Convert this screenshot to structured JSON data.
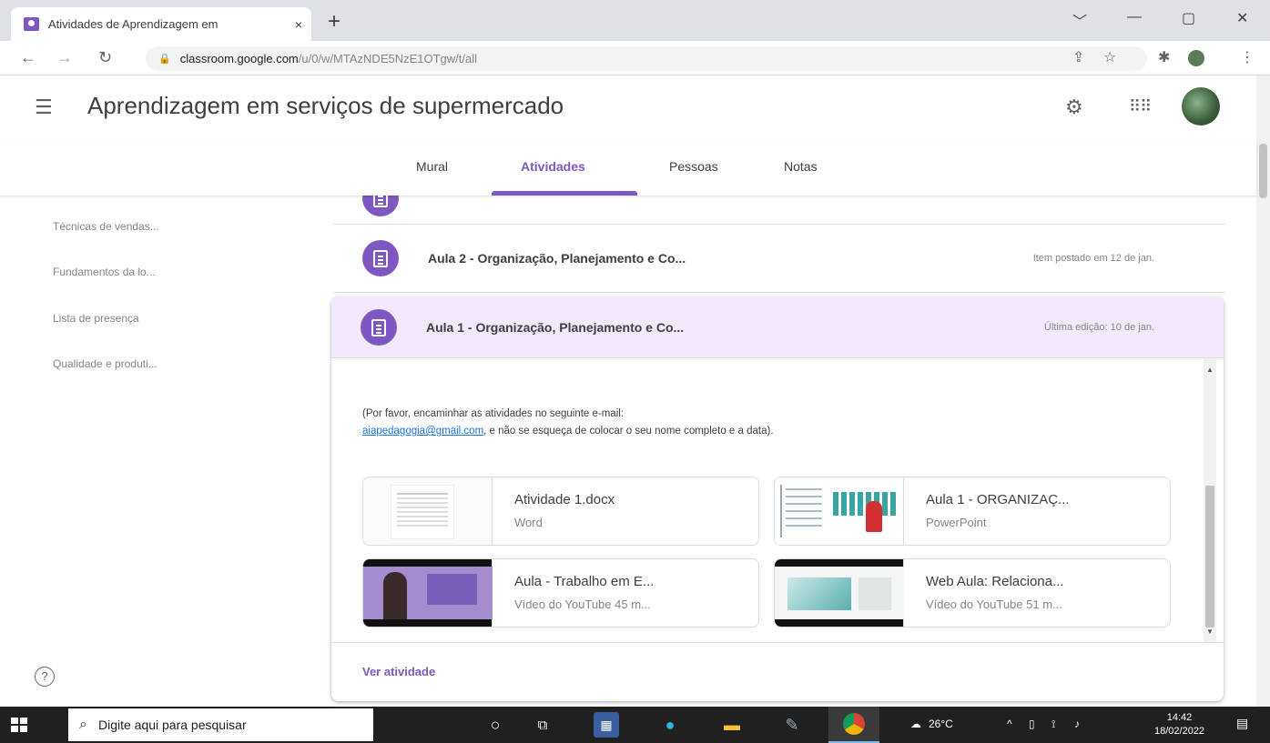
{
  "browser": {
    "tab_title": "Atividades de Aprendizagem em",
    "tab_close": "×",
    "new_tab": "+",
    "url_host": "classroom.google.com",
    "url_path": "/u/0/w/MTAzNDE5NzE1OTgw/t/all",
    "window_controls": [
      "﹀",
      "—",
      "▢",
      "✕"
    ]
  },
  "header": {
    "class_name": "Aprendizagem em serviços de supermercado"
  },
  "class_tabs": [
    "Mural",
    "Atividades",
    "Pessoas",
    "Notas"
  ],
  "active_tab": "Atividades",
  "topics": [
    "Técnicas de vendas...",
    "Fundamentos da lo...",
    "Lista de presença",
    "Qualidade e produti..."
  ],
  "items": [
    {
      "title": "Aula 2 - Organização, Planejamento e Co...",
      "meta": "Item postado em 12 de jan."
    },
    {
      "title": "Aula 1 - Organização, Planejamento e Co...",
      "meta": "Última edição: 10 de jan."
    }
  ],
  "expanded": {
    "desc_part1": "(Por favor, encaminhar as atividades no seguinte e-mail:",
    "email": "aiapedagogia@gmail.com",
    "desc_part2": ", e não se esqueça de colocar o seu nome completo e a data).",
    "attachments": [
      {
        "name": "Atividade 1.docx",
        "kind": "Word"
      },
      {
        "name": "Aula 1 - ORGANIZAÇ...",
        "kind": "PowerPoint"
      },
      {
        "name": "Aula - Trabalho em E...",
        "kind": "Vídeo do YouTube   45 m..."
      },
      {
        "name": "Web Aula: Relaciona...",
        "kind": "Vídeo do YouTube   51 m..."
      }
    ],
    "view_link": "Ver atividade"
  },
  "taskbar": {
    "search_placeholder": "Digite aqui para pesquisar",
    "weather": "26°C",
    "time": "14:42",
    "date": "18/02/2022"
  },
  "colors": {
    "accent": "#7e57c2",
    "expanded_header_bg": "#f3e8fd",
    "link": "#1a73e8"
  },
  "icons": [
    "menu-icon",
    "settings-icon",
    "apps-grid-icon",
    "assignment-icon",
    "help-icon",
    "windows-icon",
    "search-icon"
  ]
}
